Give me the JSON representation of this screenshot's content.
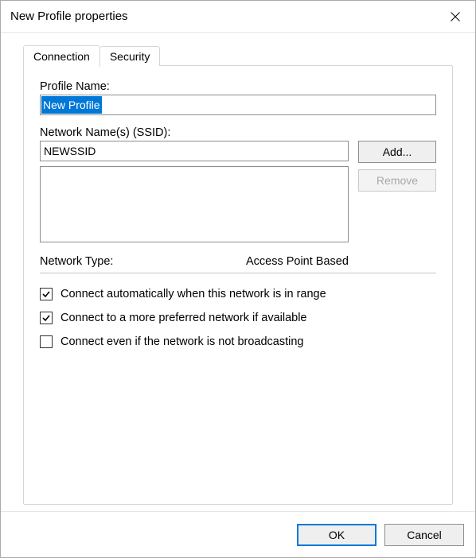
{
  "window": {
    "title": "New Profile properties"
  },
  "tabs": {
    "active": "Connection",
    "items": [
      "Connection",
      "Security"
    ]
  },
  "form": {
    "profile_name_label": "Profile Name:",
    "profile_name_value": "New Profile",
    "ssid_label": "Network Name(s) (SSID):",
    "ssid_value": "NEWSSID",
    "add_label": "Add...",
    "remove_label": "Remove",
    "network_type_label": "Network Type:",
    "network_type_value": "Access Point Based"
  },
  "checks": {
    "auto_connect": {
      "label": "Connect automatically when this network is in range",
      "checked": true
    },
    "prefer": {
      "label": "Connect to a more preferred network if available",
      "checked": true
    },
    "hidden": {
      "label": "Connect even if the network is not broadcasting",
      "checked": false
    }
  },
  "buttons": {
    "ok": "OK",
    "cancel": "Cancel"
  }
}
